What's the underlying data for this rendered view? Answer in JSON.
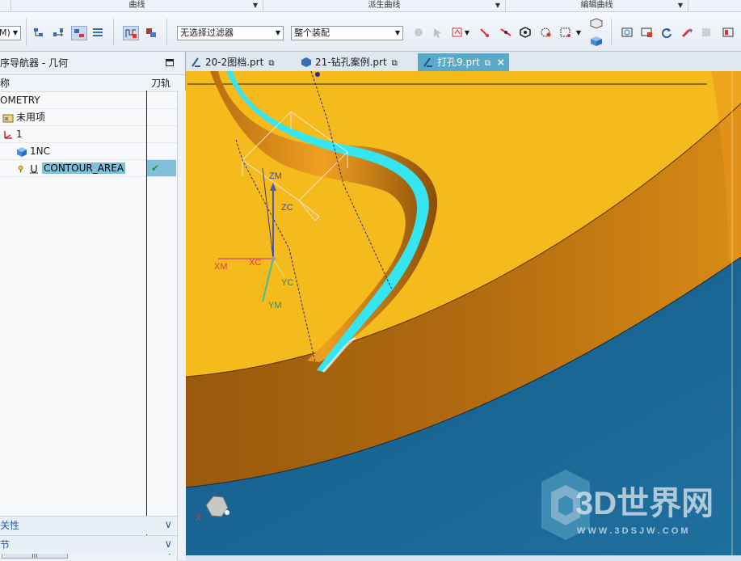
{
  "ribbon_groups": [
    "曲线",
    "派生曲线",
    "编辑曲线"
  ],
  "toolbar": {
    "mode_combo": "M)",
    "filter_combo": "无选择过滤器",
    "assembly_combo": "整个装配"
  },
  "navigator": {
    "title": "序导航器 - 几何",
    "col_name": "称",
    "col_toolpath": "刀轨",
    "tree": [
      {
        "label": "OMETRY",
        "icon": "none"
      },
      {
        "label": "未用项",
        "icon": "folder-icon"
      },
      {
        "label": "1",
        "icon": "coordinate-system-icon"
      },
      {
        "label": "1NC",
        "icon": "workpiece-icon"
      },
      {
        "label": "CONTOUR_AREA",
        "icon": "operation-icon",
        "selected": true,
        "status": "✔"
      }
    ],
    "panel_dependencies": "关性",
    "panel_details": "节"
  },
  "tabs": [
    {
      "label": "20-2图档.prt",
      "icon": "part-icon"
    },
    {
      "label": "21-钻孔案例.prt",
      "icon": "solid-part-icon"
    },
    {
      "label": "打孔9.prt",
      "icon": "part-icon",
      "active": true,
      "close": "×"
    }
  ],
  "viewport": {
    "axes": {
      "zm": "ZM",
      "zc": "ZC",
      "xm": "XM",
      "xc": "XC",
      "yc": "YC",
      "ym": "YM"
    },
    "triad_label": "X",
    "watermark_title": "3D世界网",
    "watermark_url": "W W W . 3 D S J W . C O M",
    "colors": {
      "top_face": "#f5ba1c",
      "side_face": "#a8640e",
      "blue_face": "#1f6f9e",
      "groove": "#35e6f0"
    }
  }
}
